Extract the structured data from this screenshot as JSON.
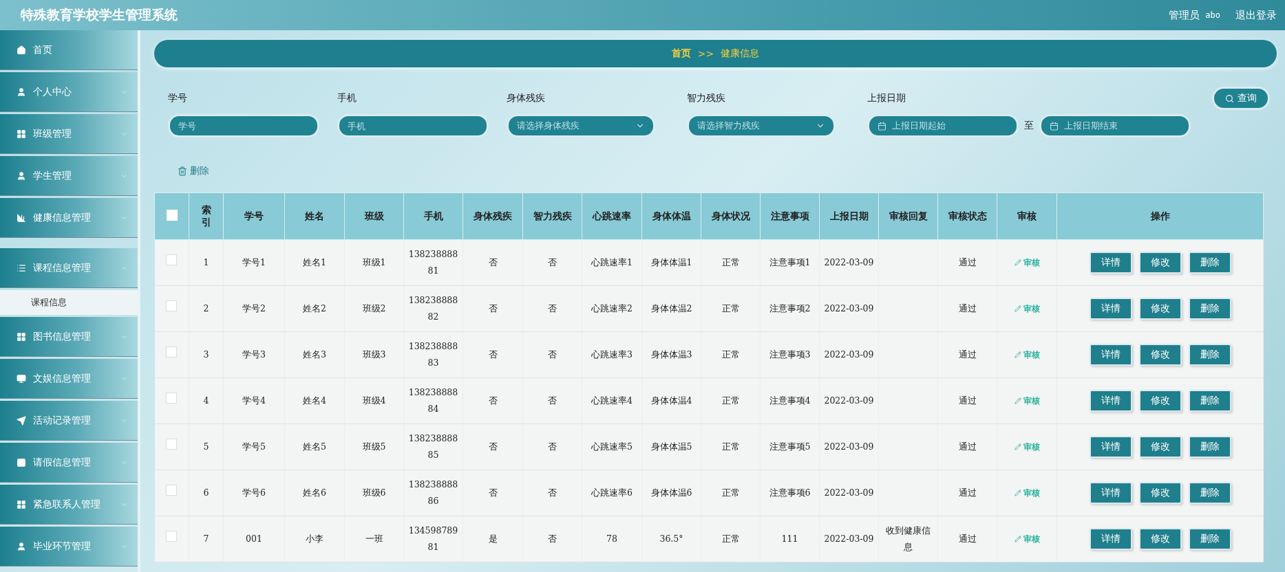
{
  "header": {
    "title": "特殊教育学校学生管理系统",
    "user_role": "管理员",
    "user_name": "abo",
    "logout": "退出登录"
  },
  "sidebar": {
    "items": [
      {
        "label": "首页",
        "kind": "link"
      },
      {
        "label": "个人中心",
        "kind": "menu",
        "expanded": false
      },
      {
        "label": "班级管理",
        "kind": "menu",
        "expanded": false
      },
      {
        "label": "学生管理",
        "kind": "menu",
        "expanded": false
      },
      {
        "label": "健康信息管理",
        "kind": "menu",
        "expanded": false
      },
      {
        "label": "课程信息管理",
        "kind": "menu",
        "expanded": true,
        "children": [
          {
            "label": "课程信息"
          }
        ]
      },
      {
        "label": "图书信息管理",
        "kind": "menu",
        "expanded": false
      },
      {
        "label": "文娱信息管理",
        "kind": "menu",
        "expanded": false
      },
      {
        "label": "活动记录管理",
        "kind": "menu",
        "expanded": false
      },
      {
        "label": "请假信息管理",
        "kind": "menu",
        "expanded": false
      },
      {
        "label": "紧急联系人管理",
        "kind": "menu",
        "expanded": false
      },
      {
        "label": "毕业环节管理",
        "kind": "menu",
        "expanded": false
      }
    ]
  },
  "breadcrumb": {
    "home": "首页",
    "separator": ">>",
    "current": "健康信息"
  },
  "filters": [
    {
      "kind": "text",
      "label": "学号",
      "placeholder": "学号"
    },
    {
      "kind": "text",
      "label": "手机",
      "placeholder": "手机"
    },
    {
      "kind": "select",
      "label": "身体残疾",
      "placeholder": "请选择身体残疾"
    },
    {
      "kind": "select",
      "label": "智力残疾",
      "placeholder": "请选择智力残疾"
    },
    {
      "kind": "date-range",
      "label": "上报日期",
      "from_placeholder": "上报日期起始",
      "to_word": "至",
      "to_placeholder": "上报日期结束"
    }
  ],
  "search_button": "查询",
  "delete_button": "删除",
  "table": {
    "select_all_checked": false,
    "columns": [
      "索引",
      "学号",
      "姓名",
      "班级",
      "手机",
      "身体残疾",
      "智力残疾",
      "心跳速率",
      "身体体温",
      "身体状况",
      "注意事项",
      "上报日期",
      "审核回复",
      "审核状态",
      "审核",
      "操作"
    ],
    "rows": [
      {
        "checked": false,
        "index": "1",
        "student_id": "学号1",
        "name": "姓名1",
        "class": "班级1",
        "phone": "13823888881",
        "physical_disability": "否",
        "intellectual_disability": "否",
        "heart_rate": "心跳速率1",
        "temperature": "身体体温1",
        "condition": "正常",
        "notes": "注意事项1",
        "report_date": "2022-03-09",
        "review_status": "通过",
        "review_link": "审核",
        "actions": [
          "详情",
          "修改",
          "删除"
        ]
      },
      {
        "checked": false,
        "index": "2",
        "student_id": "学号2",
        "name": "姓名2",
        "class": "班级2",
        "phone": "13823888882",
        "physical_disability": "否",
        "intellectual_disability": "否",
        "heart_rate": "心跳速率2",
        "temperature": "身体体温2",
        "condition": "正常",
        "notes": "注意事项2",
        "report_date": "2022-03-09",
        "review_status": "通过",
        "review_link": "审核",
        "actions": [
          "详情",
          "修改",
          "删除"
        ]
      },
      {
        "checked": false,
        "index": "3",
        "student_id": "学号3",
        "name": "姓名3",
        "class": "班级3",
        "phone": "13823888883",
        "physical_disability": "否",
        "intellectual_disability": "否",
        "heart_rate": "心跳速率3",
        "temperature": "身体体温3",
        "condition": "正常",
        "notes": "注意事项3",
        "report_date": "2022-03-09",
        "review_status": "通过",
        "review_link": "审核",
        "actions": [
          "详情",
          "修改",
          "删除"
        ]
      },
      {
        "checked": false,
        "index": "4",
        "student_id": "学号4",
        "name": "姓名4",
        "class": "班级4",
        "phone": "13823888884",
        "physical_disability": "否",
        "intellectual_disability": "否",
        "heart_rate": "心跳速率4",
        "temperature": "身体体温4",
        "condition": "正常",
        "notes": "注意事项4",
        "report_date": "2022-03-09",
        "review_status": "通过",
        "review_link": "审核",
        "actions": [
          "详情",
          "修改",
          "删除"
        ]
      },
      {
        "checked": false,
        "index": "5",
        "student_id": "学号5",
        "name": "姓名5",
        "class": "班级5",
        "phone": "13823888885",
        "physical_disability": "否",
        "intellectual_disability": "否",
        "heart_rate": "心跳速率5",
        "temperature": "身体体温5",
        "condition": "正常",
        "notes": "注意事项5",
        "report_date": "2022-03-09",
        "review_status": "通过",
        "review_link": "审核",
        "actions": [
          "详情",
          "修改",
          "删除"
        ]
      },
      {
        "checked": false,
        "index": "6",
        "student_id": "学号6",
        "name": "姓名6",
        "class": "班级6",
        "phone": "13823888886",
        "physical_disability": "否",
        "intellectual_disability": "否",
        "heart_rate": "心跳速率6",
        "temperature": "身体体温6",
        "condition": "正常",
        "notes": "注意事项6",
        "report_date": "2022-03-09",
        "review_status": "通过",
        "review_link": "审核",
        "actions": [
          "详情",
          "修改",
          "删除"
        ]
      },
      {
        "checked": false,
        "index": "7",
        "student_id": "001",
        "name": "小李",
        "class": "一班",
        "phone": "13459878981",
        "physical_disability": "是",
        "intellectual_disability": "否",
        "heart_rate": "78",
        "temperature": "36.5°",
        "condition": "正常",
        "notes": "111",
        "report_date": "2022-03-09",
        "review_reply": "收到健康信息",
        "review_status": "通过",
        "review_link": "审核",
        "actions": [
          "详情",
          "修改",
          "删除"
        ]
      }
    ]
  }
}
